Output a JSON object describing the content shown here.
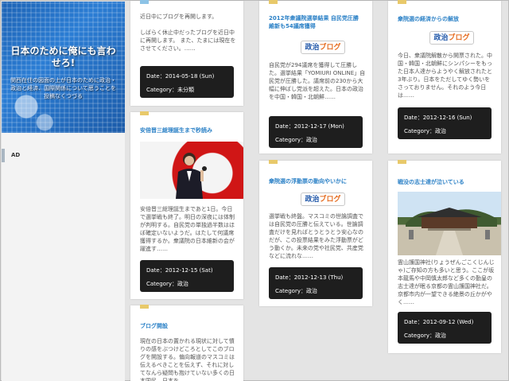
{
  "sidebar": {
    "title": "日本のために俺にも言わせろ!",
    "subtitle": "関西在住の図面の上が日本のために政治・政治と経済、国際関係について思うことを投稿なくつづる",
    "ad_label": "AD"
  },
  "cards": [
    {
      "text": "近日中にブログを再開します。\n\nしばらく休止中だったブログを近日中に再開します。 また、たまには現在をさせてください。……",
      "date": "Date：2014-05-18 (Sun)",
      "category": "Category：未分類"
    },
    {
      "title": "安倍晋三総理誕生まで秒読み",
      "text": "安倍晋三総理誕生まであと1日。今日で選挙戦も終了。明日の深夜には体制が判明する。自民党の単独過半数はほぼ確定いないようだ。はたして何議席獲得するか。衆議院の日本維新の会が躍進す……",
      "date": "Date：2012-12-15 (Sat)",
      "category": "Category：政治"
    },
    {
      "title": "ブログ開設",
      "text": "現在の日本の置かれる現状に対して憤りの感をぶつけどころとしてこのブログを開設する。偏向報道のマスコミは伝えるべきことを伝えず、それに対してなんら疑問も抱けていない多くの日本国民。日本を……"
    },
    {
      "title": "2012年衆議院選挙結果 自民党圧勝 維新も54議席獲得",
      "logo_a": "政治",
      "logo_b": "ブログ",
      "text": "自民党が294議席を獲得して圧勝した。選挙結果「YOMIURI ONLINE」自民党が圧勝した。議席前の230から大幅に伸ばし党派を超えた。日本の政治を中国・韓国・北朝鮮……",
      "date": "Date：2012-12-17 (Mon)",
      "category": "Category：政治"
    },
    {
      "title": "衆院選の浮動票の動向やいかに",
      "logo_a": "政治",
      "logo_b": "ブログ",
      "text": "選挙戦も終盤。マスコミの世論調査では自民党の圧勝と伝えている。世論調査だけを見ればとうとうとう安心なのだが、この投票結果をみた浮動票がどう動くか。未来の党や社民党、共産党などに流れな……",
      "date": "Date：2012-12-13 (Thu)",
      "category": "Category：政治"
    },
    {
      "title": "衆院選の経済からの解放",
      "logo_a": "政治",
      "logo_b": "ブログ",
      "text": "今日、衆議院解散から開票された。中国・韓国・北朝鮮にシンパシーをもった日本人達からようやく解放されたと3年ぶり。日本をただしてゆく勢いをさっておりません。それのよう今日は……",
      "date": "Date：2012-12-16 (Sun)",
      "category": "Category：政治"
    },
    {
      "title": "戦没の志士達が泣いている",
      "text": "霊山護国神社(りょうぜんごこくじんじゃ)ご存知の方も多いと思う。ここが坂本龍馬や中岡慎太郎など多くの勤皇の志士達が眠る京都の霊山護国神社だ。京都市内が一望できる絶景の丘かがやく……",
      "date": "Date：2012-09-12 (Wed)",
      "category": "Category：政治"
    }
  ]
}
